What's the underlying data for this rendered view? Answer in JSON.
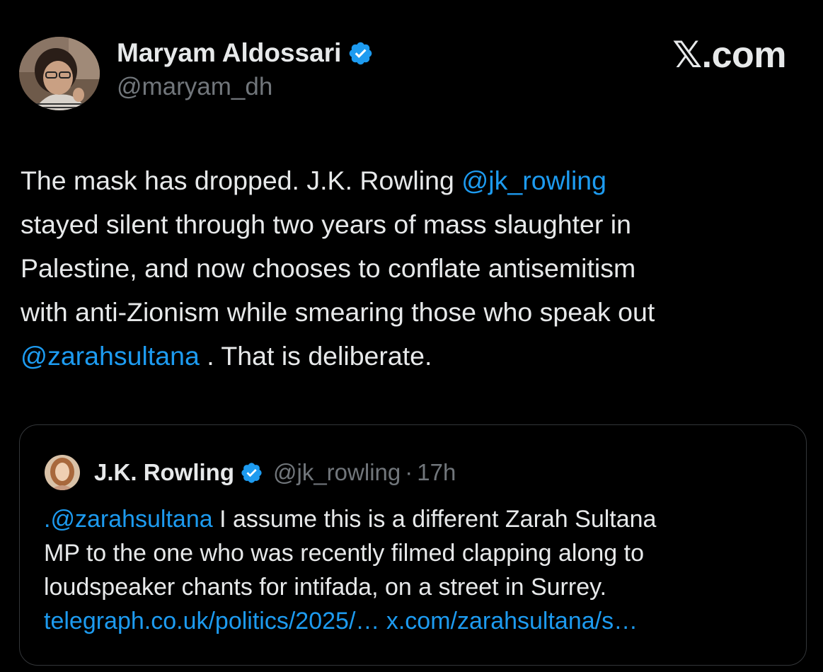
{
  "brand": "𝕏.com",
  "author": {
    "name": "Maryam Aldossari",
    "handle": "@maryam_dh"
  },
  "tweet": {
    "line1_text": "The mask has dropped. J.K. Rowling ",
    "line1_mention": "@jk_rowling",
    "line2": "stayed silent through two years of mass slaughter in",
    "line3": "Palestine, and now chooses to conflate antisemitism",
    "line4": "with anti-Zionism while smearing those who speak out",
    "line5_mention": "@zarahsultana",
    "line5_text": " . That is deliberate."
  },
  "quote": {
    "name": "J.K. Rowling",
    "handle": "@jk_rowling",
    "dot": "·",
    "time": "17h",
    "line1_mention": ".@zarahsultana",
    "line1_text": " I assume this is a different Zarah Sultana",
    "line2": "MP to the one who was recently filmed clapping along to",
    "line3": "loudspeaker chants for intifada, on a street in Surrey.",
    "link1": "telegraph.co.uk/politics/2025/…",
    "link2": "x.com/zarahsultana/s…"
  },
  "icons": {
    "verified": "verified-badge-icon"
  },
  "colors": {
    "background": "#000000",
    "text": "#e7e9ea",
    "secondary": "#71767b",
    "accent": "#1d9bf0",
    "border": "#333639"
  }
}
